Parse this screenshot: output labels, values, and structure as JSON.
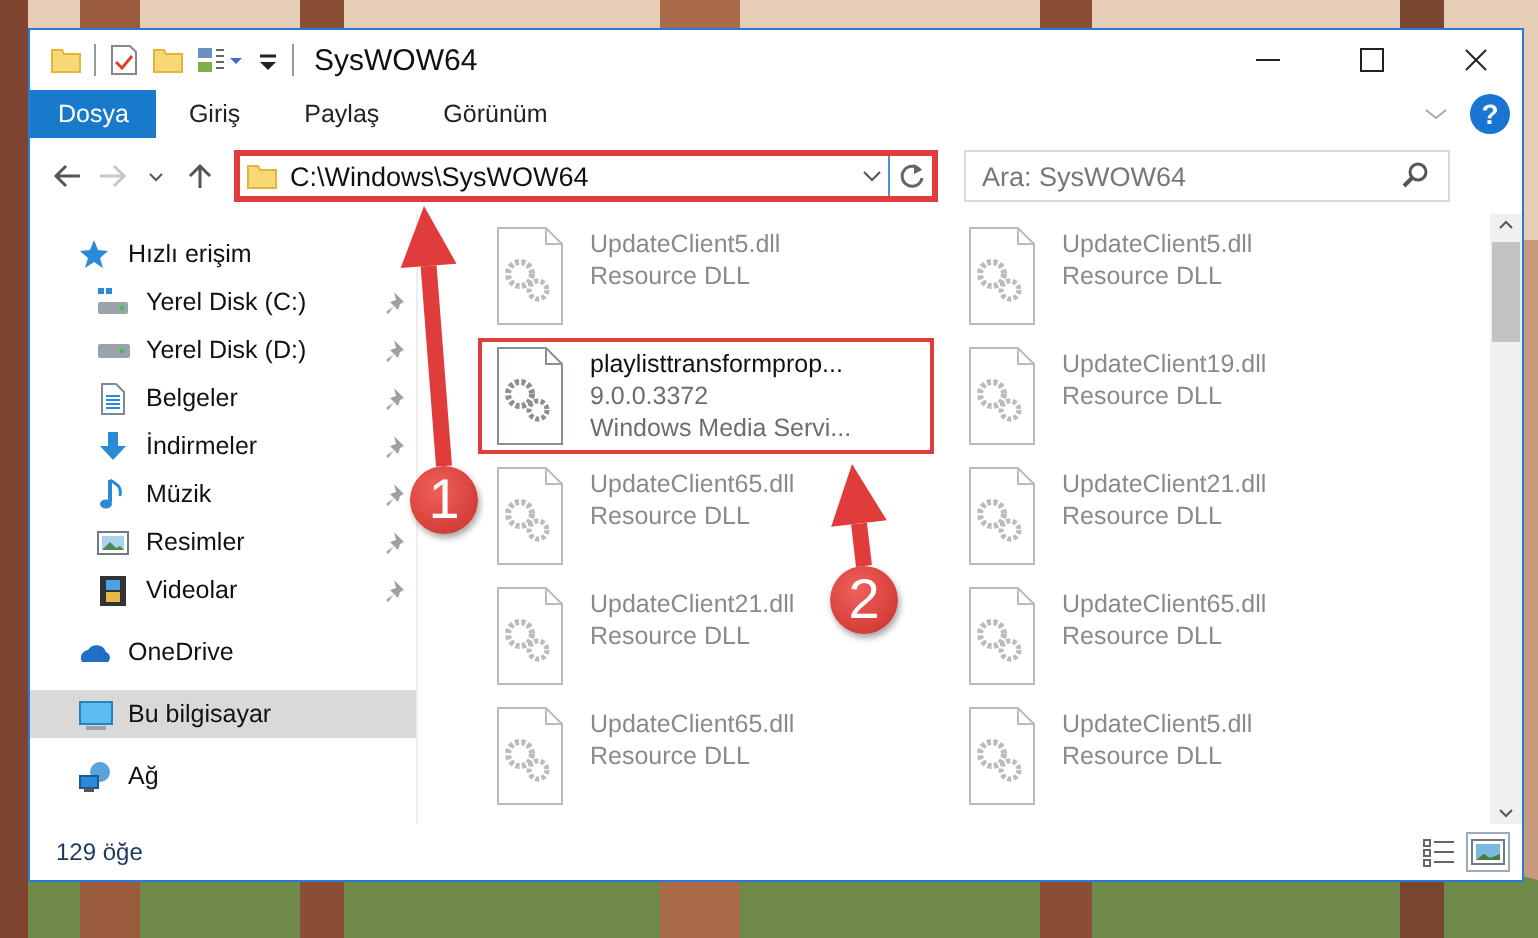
{
  "window": {
    "title": "SysWOW64"
  },
  "ribbon": {
    "tabs": [
      {
        "label": "Dosya",
        "selected": true
      },
      {
        "label": "Giriş",
        "selected": false
      },
      {
        "label": "Paylaş",
        "selected": false
      },
      {
        "label": "Görünüm",
        "selected": false
      }
    ],
    "help": "?"
  },
  "navigation": {
    "back_enabled": true,
    "forward_enabled": false
  },
  "address_bar": {
    "value": "C:\\Windows\\SysWOW64",
    "highlighted": true
  },
  "search": {
    "placeholder": "Ara: SysWOW64"
  },
  "sidebar": {
    "items": [
      {
        "label": "Hızlı erişim",
        "kind": "star",
        "selected": false,
        "children": [
          {
            "label": "Yerel Disk (C:)",
            "kind": "system-drive",
            "pinned": true,
            "selected": false
          },
          {
            "label": "Yerel Disk (D:)",
            "kind": "drive",
            "pinned": true,
            "selected": false
          },
          {
            "label": "Belgeler",
            "kind": "document",
            "pinned": true,
            "selected": false
          },
          {
            "label": "İndirmeler",
            "kind": "download",
            "pinned": true,
            "selected": false
          },
          {
            "label": "Müzik",
            "kind": "music",
            "pinned": true,
            "selected": false
          },
          {
            "label": "Resimler",
            "kind": "pictures",
            "pinned": true,
            "selected": false
          },
          {
            "label": "Videolar",
            "kind": "video",
            "pinned": true,
            "selected": false
          }
        ]
      },
      {
        "label": "OneDrive",
        "kind": "cloud",
        "selected": false
      },
      {
        "label": "Bu bilgisayar",
        "kind": "computer",
        "selected": true
      },
      {
        "label": "Ağ",
        "kind": "network",
        "selected": false
      }
    ]
  },
  "files": [
    {
      "lines": [
        "UpdateClient5.dll",
        "Resource DLL"
      ],
      "blurred": true,
      "highlighted": false
    },
    {
      "lines": [
        "UpdateClient5.dll",
        "Resource DLL"
      ],
      "blurred": true,
      "highlighted": false
    },
    {
      "lines": [
        "playlisttransformprop...",
        "9.0.0.3372",
        "Windows Media Servi..."
      ],
      "blurred": false,
      "highlighted": true
    },
    {
      "lines": [
        "UpdateClient19.dll",
        "Resource DLL"
      ],
      "blurred": true,
      "highlighted": false
    },
    {
      "lines": [
        "UpdateClient65.dll",
        "Resource DLL"
      ],
      "blurred": true,
      "highlighted": false
    },
    {
      "lines": [
        "UpdateClient21.dll",
        "Resource DLL"
      ],
      "blurred": true,
      "highlighted": false
    },
    {
      "lines": [
        "UpdateClient21.dll",
        "Resource DLL"
      ],
      "blurred": true,
      "highlighted": false
    },
    {
      "lines": [
        "UpdateClient65.dll",
        "Resource DLL"
      ],
      "blurred": true,
      "highlighted": false
    },
    {
      "lines": [
        "UpdateClient65.dll",
        "Resource DLL"
      ],
      "blurred": true,
      "highlighted": false
    },
    {
      "lines": [
        "UpdateClient5.dll",
        "Resource DLL"
      ],
      "blurred": true,
      "highlighted": false
    }
  ],
  "status_bar": {
    "count": "129 öğe",
    "views": [
      {
        "kind": "details",
        "selected": false
      },
      {
        "kind": "large-icons",
        "selected": true
      }
    ]
  },
  "callouts": [
    {
      "number": "1"
    },
    {
      "number": "2"
    }
  ]
}
